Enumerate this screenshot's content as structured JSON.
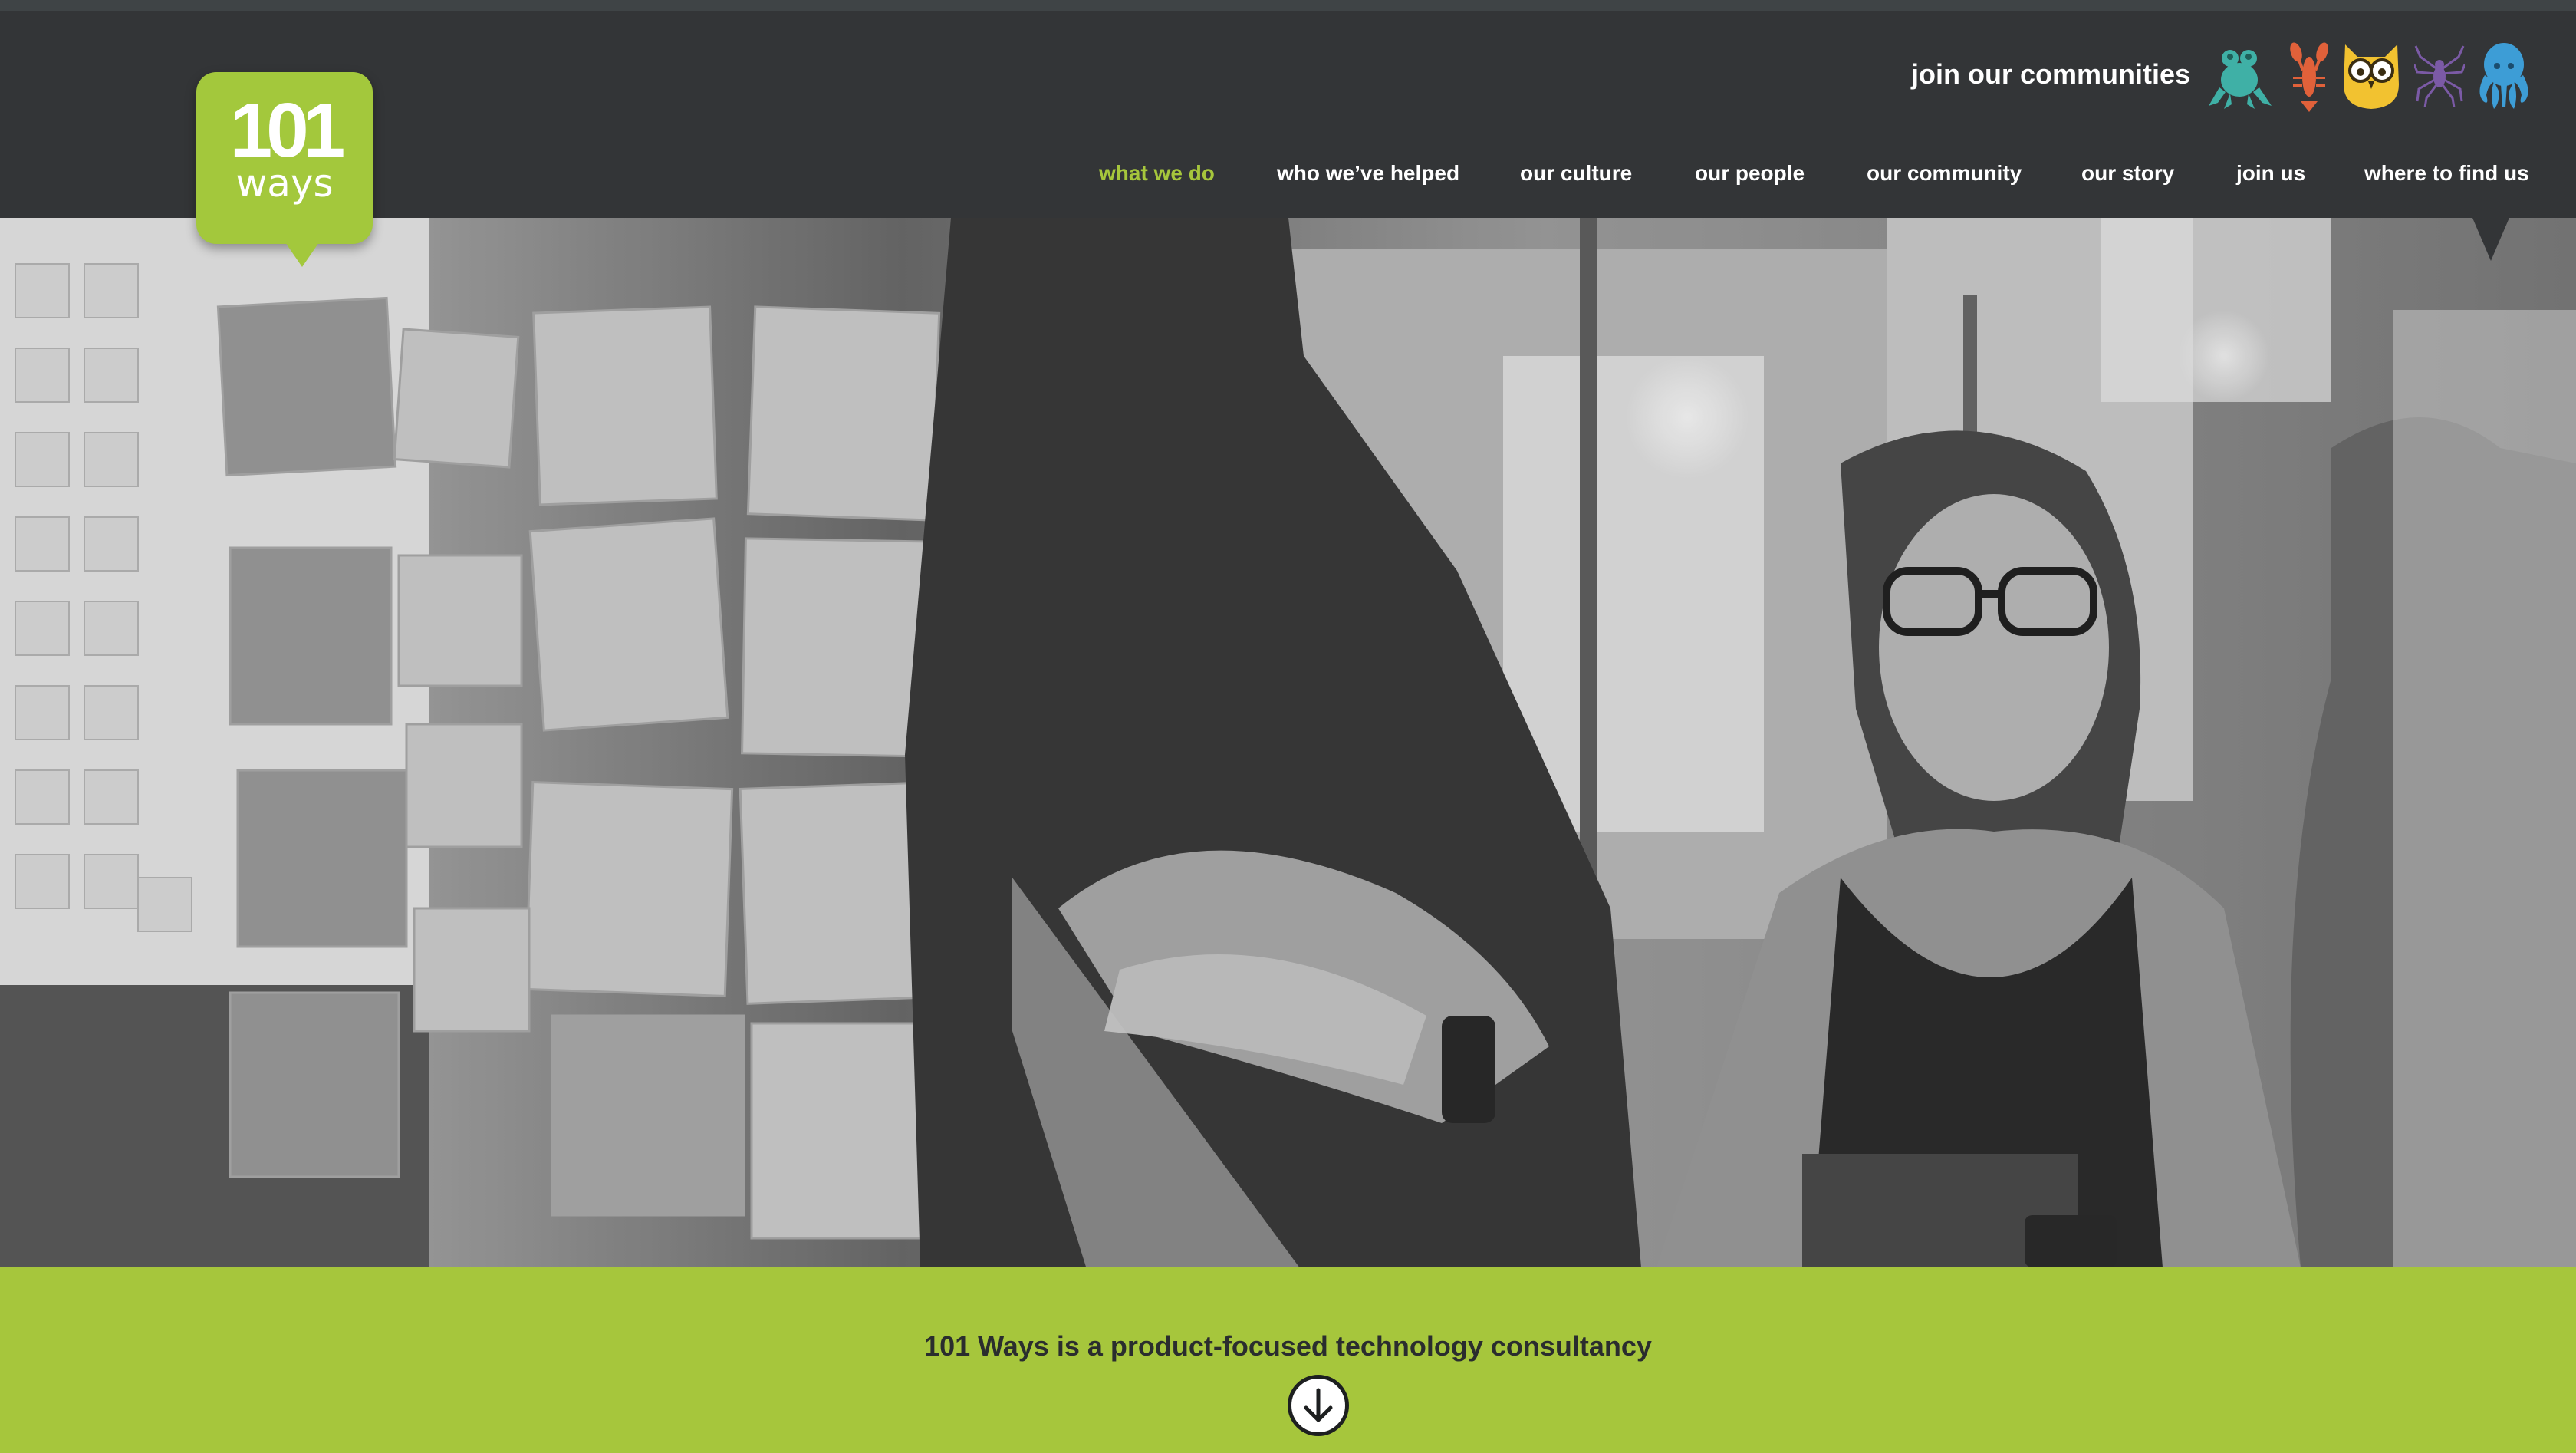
{
  "brand": {
    "logo_number": "101",
    "logo_word": "ways",
    "green": "#a6c63c",
    "dark": "#333537"
  },
  "communities": {
    "label": "join our communities",
    "icons": [
      "frog-icon",
      "lobster-icon",
      "owl-icon",
      "spider-icon",
      "octopus-icon"
    ],
    "icon_colors": [
      "#3fb0a6",
      "#e1613a",
      "#f2c230",
      "#7b5aa6",
      "#3d9dd6"
    ]
  },
  "nav": {
    "items": [
      {
        "label": "what we do",
        "active": true
      },
      {
        "label": "who we’ve helped",
        "active": false
      },
      {
        "label": "our culture",
        "active": false
      },
      {
        "label": "our people",
        "active": false
      },
      {
        "label": "our community",
        "active": false
      },
      {
        "label": "our story",
        "active": false
      },
      {
        "label": "join us",
        "active": false
      },
      {
        "label": "where to find us",
        "active": false
      }
    ]
  },
  "hero": {
    "image_style": "grayscale photograph"
  },
  "intro": {
    "tagline": "101 Ways is a product-focused technology consultancy",
    "scroll_icon": "arrow-down-circle-icon"
  }
}
